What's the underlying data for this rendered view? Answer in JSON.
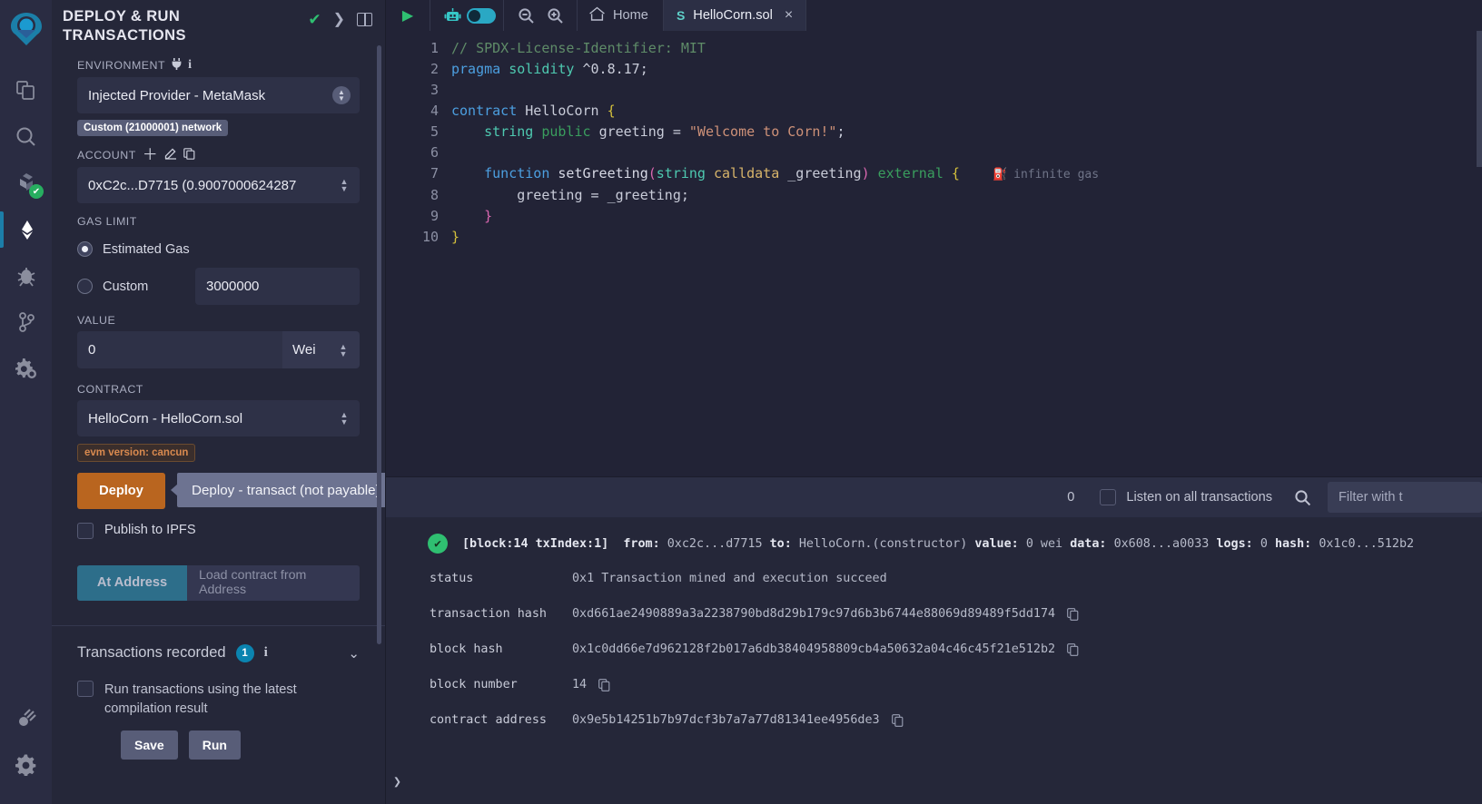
{
  "rail": {
    "logo": "remix-logo-icon",
    "items": [
      {
        "name": "file-explorer-icon"
      },
      {
        "name": "search-icon"
      },
      {
        "name": "solidity-compiler-icon",
        "badge": "✔"
      },
      {
        "name": "deploy-run-transactions-icon",
        "active": true
      },
      {
        "name": "debugger-icon"
      },
      {
        "name": "git-icon"
      },
      {
        "name": "plugin-manager-icon"
      }
    ],
    "bottom": [
      {
        "name": "plugin-icon"
      },
      {
        "name": "settings-gear-icon"
      }
    ]
  },
  "panel": {
    "title": "DEPLOY & RUN TRANSACTIONS",
    "header_icons": [
      "check-icon",
      "chevron-right-icon",
      "layout-panel-icon"
    ],
    "environment": {
      "label": "ENVIRONMENT",
      "value": "Injected Provider - MetaMask",
      "network_tag": "Custom (21000001) network"
    },
    "account": {
      "label": "ACCOUNT",
      "value": "0xC2c...D7715 (0.9007000624287 "
    },
    "gas_limit": {
      "label": "GAS LIMIT",
      "estimated_label": "Estimated Gas",
      "custom_label": "Custom",
      "custom_value": "3000000"
    },
    "value_field": {
      "label": "VALUE",
      "amount": "0",
      "unit": "Wei"
    },
    "contract": {
      "label": "CONTRACT",
      "value": "HelloCorn - HelloCorn.sol",
      "evm_tag": "evm version: cancun"
    },
    "deploy": {
      "button": "Deploy",
      "tooltip": "Deploy - transact (not payable)",
      "publish_ipfs": "Publish to IPFS"
    },
    "at_address": {
      "button": "At Address",
      "placeholder": "Load contract from Address"
    },
    "transactions_recorded": {
      "title": "Transactions recorded",
      "count": "1"
    },
    "run_latest": {
      "label": "Run transactions using the latest compilation result",
      "save": "Save",
      "run": "Run"
    }
  },
  "topbar": {
    "play_icon": "run-script-icon",
    "robot_icon": "ai-assistant-icon",
    "toggle_icon": "ai-toggle-switch",
    "zoom_out_icon": "zoom-out-icon",
    "zoom_in_icon": "zoom-in-icon",
    "home_label": "Home",
    "tab_label": "HelloCorn.sol",
    "tab_close": "×"
  },
  "editor": {
    "lines": [
      {
        "n": "1",
        "parts": [
          {
            "t": "// SPDX-License-Identifier: MIT",
            "c": "c-comment"
          }
        ]
      },
      {
        "n": "2",
        "parts": [
          {
            "t": "pragma ",
            "c": "c-kw"
          },
          {
            "t": "solidity ",
            "c": "c-type"
          },
          {
            "t": "^0.8.17;",
            "c": "c-id"
          }
        ]
      },
      {
        "n": "3",
        "parts": []
      },
      {
        "n": "4",
        "parts": [
          {
            "t": "contract ",
            "c": "c-kw"
          },
          {
            "t": "HelloCorn ",
            "c": "c-id"
          },
          {
            "t": "{",
            "c": "c-brace-y"
          }
        ]
      },
      {
        "n": "5",
        "parts": [
          {
            "t": "    ",
            "c": "c-id"
          },
          {
            "t": "string ",
            "c": "c-type"
          },
          {
            "t": "public ",
            "c": "c-vis"
          },
          {
            "t": "greeting = ",
            "c": "c-id"
          },
          {
            "t": "\"Welcome to Corn!\"",
            "c": "c-str"
          },
          {
            "t": ";",
            "c": "c-id"
          }
        ]
      },
      {
        "n": "6",
        "parts": []
      },
      {
        "n": "7",
        "parts": [
          {
            "t": "    ",
            "c": "c-id"
          },
          {
            "t": "function ",
            "c": "c-kw"
          },
          {
            "t": "setGreeting",
            "c": "c-fn"
          },
          {
            "t": "(",
            "c": "c-brace-p"
          },
          {
            "t": "string ",
            "c": "c-type"
          },
          {
            "t": "calldata ",
            "c": "c-param"
          },
          {
            "t": "_greeting",
            "c": "c-id"
          },
          {
            "t": ")",
            "c": "c-brace-p"
          },
          {
            "t": " external ",
            "c": "c-vis"
          },
          {
            "t": "{",
            "c": "c-brace-y"
          }
        ],
        "gas": "infinite gas"
      },
      {
        "n": "8",
        "parts": [
          {
            "t": "        greeting = _greeting;",
            "c": "c-id"
          }
        ]
      },
      {
        "n": "9",
        "parts": [
          {
            "t": "    ",
            "c": "c-id"
          },
          {
            "t": "}",
            "c": "c-brace-p"
          }
        ]
      },
      {
        "n": "10",
        "parts": [
          {
            "t": "}",
            "c": "c-brace-y"
          }
        ]
      }
    ]
  },
  "terminal": {
    "count": "0",
    "listen_label": "Listen on all transactions",
    "search_icon": "search-icon",
    "filter_placeholder": "Filter with t",
    "log": {
      "status_icon": "success-check-icon",
      "block": "[block:14 txIndex:1]",
      "from_label": "from:",
      "from": "0xc2c...d7715",
      "to_label": "to:",
      "to": "HelloCorn.(constructor)",
      "value_label": "value:",
      "value": "0 wei",
      "data_label": "data:",
      "data": "0x608...a0033",
      "logs_label": "logs:",
      "logs": "0",
      "hash_label": "hash:",
      "hash": "0x1c0...512b2"
    },
    "details": [
      {
        "key": "status",
        "value": "0x1 Transaction mined and execution succeed",
        "copy": false
      },
      {
        "key": "transaction hash",
        "value": "0xd661ae2490889a3a2238790bd8d29b179c97d6b3b6744e88069d89489f5dd174",
        "copy": true
      },
      {
        "key": "block hash",
        "value": "0x1c0dd66e7d962128f2b017a6db38404958809cb4a50632a04c46c45f21e512b2",
        "copy": true
      },
      {
        "key": "block number",
        "value": "14",
        "copy": true
      },
      {
        "key": "contract address",
        "value": "0x9e5b14251b7b97dcf3b7a7a77d81341ee4956de3",
        "copy": true
      }
    ],
    "expand_icon": "chevron-right-icon"
  },
  "colors": {
    "accent_deploy": "#b9651f",
    "accent_at_address": "#2d6e8a",
    "success": "#2fbf71",
    "badge_blue": "#0b84b0",
    "evm_tag": "#d98a4f"
  }
}
